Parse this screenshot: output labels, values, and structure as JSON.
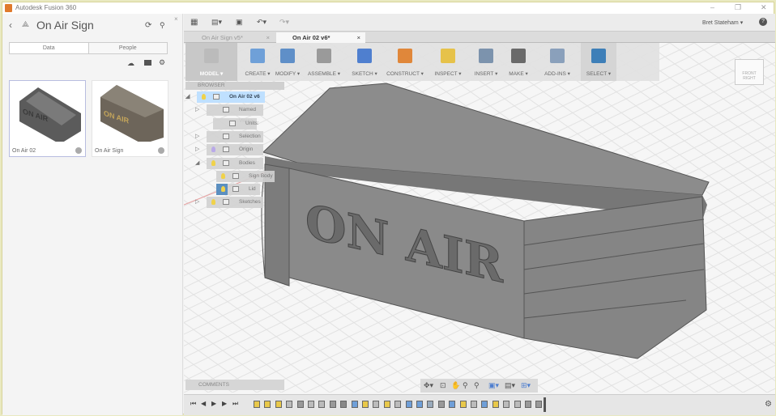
{
  "window": {
    "title": "Autodesk Fusion 360",
    "min": "–",
    "max": "❐",
    "close": "✕"
  },
  "data_panel": {
    "project": "On Air Sign",
    "tabs": [
      "Data",
      "People"
    ],
    "items": [
      {
        "name": "On Air 02"
      },
      {
        "name": "On Air Sign"
      }
    ]
  },
  "header": {
    "user": "Bret Stateham ▾",
    "help": "?"
  },
  "doc_tabs": [
    {
      "label": "On Air Sign v5*"
    },
    {
      "label": "On Air 02 v6*"
    }
  ],
  "ribbon": [
    {
      "label": "MODEL ▾",
      "color": "#bbbbbb"
    },
    {
      "label": "CREATE ▾",
      "color": "#6fa0d8"
    },
    {
      "label": "MODIFY ▾",
      "color": "#5f8fc8"
    },
    {
      "label": "ASSEMBLE ▾",
      "color": "#9a9a9a"
    },
    {
      "label": "SKETCH ▾",
      "color": "#4f7fcf"
    },
    {
      "label": "CONSTRUCT ▾",
      "color": "#e0873a"
    },
    {
      "label": "INSPECT ▾",
      "color": "#e6c24a"
    },
    {
      "label": "INSERT ▾",
      "color": "#7c93ad"
    },
    {
      "label": "MAKE ▾",
      "color": "#6a6a6a"
    },
    {
      "label": "ADD-INS ▾",
      "color": "#8aa0bb"
    },
    {
      "label": "SELECT ▾",
      "color": "#3e7fb8"
    }
  ],
  "browser": {
    "title": "BROWSER",
    "nodes": [
      {
        "label": "On Air 02 v6"
      },
      {
        "label": "Named Views"
      },
      {
        "label": "Units: mm"
      },
      {
        "label": "Selection Sets"
      },
      {
        "label": "Origin"
      },
      {
        "label": "Bodies"
      },
      {
        "label": "Sign Body"
      },
      {
        "label": "Lid"
      },
      {
        "label": "Sketches"
      }
    ]
  },
  "model": {
    "text": "ON AIR"
  },
  "viewcube": {
    "front": "FRONT",
    "right": "RIGHT"
  },
  "comments": {
    "title": "COMMENTS"
  },
  "timeline": {
    "controls": [
      "⏮",
      "◀",
      "▶",
      "▶",
      "⏭"
    ],
    "features": [
      "s",
      "s",
      "s",
      "e",
      "m",
      "e",
      "e",
      "m",
      "l",
      "f",
      "s",
      "e",
      "s",
      "e",
      "f",
      "f",
      "b",
      "m",
      "f",
      "s",
      "e",
      "f",
      "s",
      "e",
      "e",
      "m",
      "m"
    ]
  }
}
